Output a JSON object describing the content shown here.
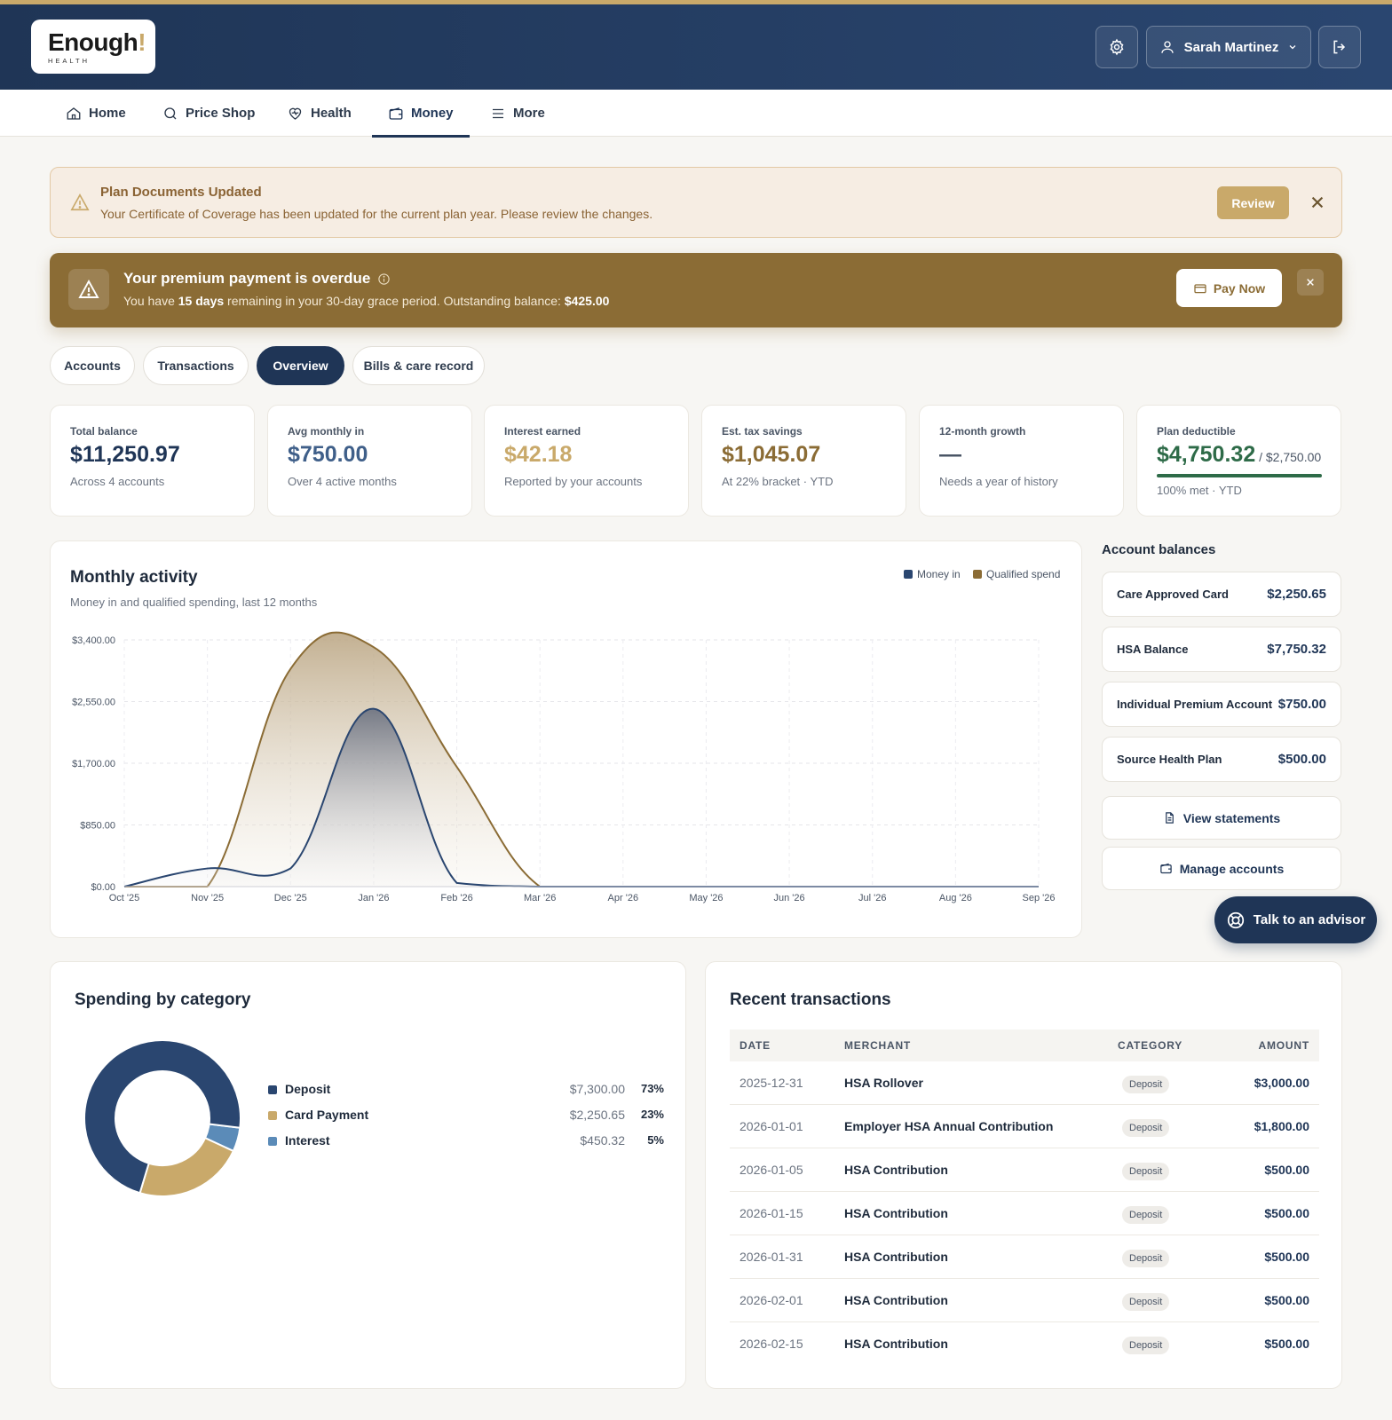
{
  "brand": {
    "wordmark": "Enough",
    "bang": "!",
    "sub": "HEALTH"
  },
  "header": {
    "user_name": "Sarah Martinez"
  },
  "nav": [
    {
      "label": "Home"
    },
    {
      "label": "Price Shop"
    },
    {
      "label": "Health"
    },
    {
      "label": "Money"
    },
    {
      "label": "More"
    }
  ],
  "notice": {
    "title": "Plan Documents Updated",
    "message": "Your Certificate of Coverage has been updated for the current plan year. Please review the changes.",
    "action": "Review"
  },
  "overdue": {
    "title": "Your premium payment is overdue",
    "msg_prefix": "You have ",
    "days": "15 days",
    "msg_mid": " remaining in your 30-day grace period. Outstanding balance: ",
    "balance": "$425.00",
    "action": "Pay Now"
  },
  "tabs": [
    {
      "label": "Accounts"
    },
    {
      "label": "Transactions"
    },
    {
      "label": "Overview"
    },
    {
      "label": "Bills & care record"
    }
  ],
  "kpis": [
    {
      "label": "Total balance",
      "value": "$11,250.97",
      "sub": "Across 4 accounts",
      "color": "#1f3556"
    },
    {
      "label": "Avg monthly in",
      "value": "$750.00",
      "sub": "Over 4 active months",
      "color": "#3f5f89"
    },
    {
      "label": "Interest earned",
      "value": "$42.18",
      "sub": "Reported by your accounts",
      "color": "#c9a96a"
    },
    {
      "label": "Est. tax savings",
      "value": "$1,045.07",
      "sub": "At 22% bracket · YTD",
      "color": "#8b6c35"
    },
    {
      "label": "12-month growth",
      "value": "—",
      "sub": "Needs a year of history",
      "color": "#4a5565"
    },
    {
      "label": "Plan deductible",
      "value": "$4,750.32",
      "value_tail": " / $2,750.00",
      "sub": "100% met · YTD",
      "color": "#2e6b48",
      "progress": 1.0
    }
  ],
  "activity": {
    "title": "Monthly activity",
    "subtitle": "Money in and qualified spending, last 12 months"
  },
  "chart_data": {
    "type": "area",
    "x": [
      "Oct '25",
      "Nov '25",
      "Dec '25",
      "Jan '26",
      "Feb '26",
      "Mar '26",
      "Apr '26",
      "May '26",
      "Jun '26",
      "Jul '26",
      "Aug '26",
      "Sep '26"
    ],
    "y_ticks": [
      "$0.00",
      "$850.00",
      "$1,700.00",
      "$2,550.00",
      "$3,400.00"
    ],
    "ylim": [
      0,
      3400
    ],
    "grid": true,
    "legend_position": "top-right",
    "series": [
      {
        "name": "Money in",
        "color": "#2a4670",
        "values": [
          0,
          250,
          250,
          2450,
          50,
          0,
          0,
          0,
          0,
          0,
          0,
          0
        ]
      },
      {
        "name": "Qualified spend",
        "color": "#8b6c35",
        "values": [
          0,
          0,
          3000,
          3300,
          1650,
          0,
          0,
          0,
          0,
          0,
          0,
          0
        ]
      }
    ]
  },
  "accounts": {
    "title": "Account balances",
    "items": [
      {
        "name": "Care Approved Card",
        "amount": "$2,250.65"
      },
      {
        "name": "HSA Balance",
        "amount": "$7,750.32"
      },
      {
        "name": "Individual Premium Account",
        "amount": "$750.00"
      },
      {
        "name": "Source Health Plan",
        "amount": "$500.00"
      }
    ],
    "view_statements": "View statements",
    "manage_accounts": "Manage accounts"
  },
  "advisor": "Talk to an advisor",
  "spending": {
    "title": "Spending by category",
    "categories": [
      {
        "name": "Deposit",
        "amount": "$7,300.00",
        "pct": "73%",
        "share": 0.73,
        "color": "#2a4670"
      },
      {
        "name": "Card Payment",
        "amount": "$2,250.65",
        "pct": "23%",
        "share": 0.23,
        "color": "#c9a96a"
      },
      {
        "name": "Interest",
        "amount": "$450.32",
        "pct": "5%",
        "share": 0.05,
        "color": "#5b8bb8"
      }
    ]
  },
  "transactions": {
    "title": "Recent transactions",
    "columns": [
      "DATE",
      "MERCHANT",
      "CATEGORY",
      "AMOUNT"
    ],
    "rows": [
      {
        "date": "2025-12-31",
        "merchant": "HSA Rollover",
        "category": "Deposit",
        "amount": "$3,000.00"
      },
      {
        "date": "2026-01-01",
        "merchant": "Employer HSA Annual Contribution",
        "category": "Deposit",
        "amount": "$1,800.00"
      },
      {
        "date": "2026-01-05",
        "merchant": "HSA Contribution",
        "category": "Deposit",
        "amount": "$500.00"
      },
      {
        "date": "2026-01-15",
        "merchant": "HSA Contribution",
        "category": "Deposit",
        "amount": "$500.00"
      },
      {
        "date": "2026-01-31",
        "merchant": "HSA Contribution",
        "category": "Deposit",
        "amount": "$500.00"
      },
      {
        "date": "2026-02-01",
        "merchant": "HSA Contribution",
        "category": "Deposit",
        "amount": "$500.00"
      },
      {
        "date": "2026-02-15",
        "merchant": "HSA Contribution",
        "category": "Deposit",
        "amount": "$500.00"
      }
    ]
  }
}
